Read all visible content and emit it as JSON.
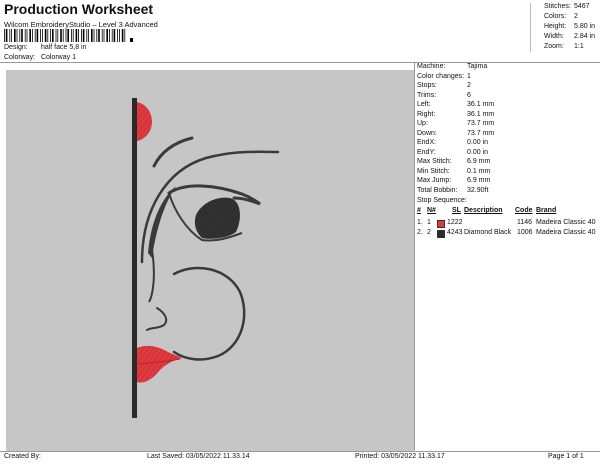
{
  "header": {
    "title": "Production Worksheet",
    "subtitle": "Wilcom EmbroideryStudio – Level 3 Advanced",
    "design_label": "Design:",
    "design_value": "half face 5,8 in",
    "colorway_label": "Colorway:",
    "colorway_value": "Colorway 1"
  },
  "summary": [
    {
      "label": "Stitches:",
      "value": "5467"
    },
    {
      "label": "Colors:",
      "value": "2"
    },
    {
      "label": "Height:",
      "value": "5.80 in"
    },
    {
      "label": "Width:",
      "value": "2.84 in"
    },
    {
      "label": "Zoom:",
      "value": "1:1"
    }
  ],
  "machine_info": [
    {
      "label": "Machine:",
      "value": "Tajima"
    },
    {
      "label": "Color changes:",
      "value": "1"
    },
    {
      "label": "Stops:",
      "value": "2"
    },
    {
      "label": "Trims:",
      "value": "6"
    },
    {
      "label": "Left:",
      "value": "36.1 mm"
    },
    {
      "label": "Right:",
      "value": "36.1 mm"
    },
    {
      "label": "Up:",
      "value": "73.7 mm"
    },
    {
      "label": "Down:",
      "value": "73.7 mm"
    },
    {
      "label": "EndX:",
      "value": "0.00 in"
    },
    {
      "label": "EndY:",
      "value": "0.00 in"
    },
    {
      "label": "Max Stitch:",
      "value": "6.9 mm"
    },
    {
      "label": "Min Stitch:",
      "value": "0.1 mm"
    },
    {
      "label": "Max Jump:",
      "value": "6.9 mm"
    },
    {
      "label": "Total Bobbin:",
      "value": "32.90ft"
    }
  ],
  "stop_sequence": {
    "title": "Stop Sequence:",
    "headers": [
      "#",
      "N#",
      "SL",
      "Description",
      "Code",
      "Brand"
    ],
    "rows": [
      {
        "idx": "1.",
        "n": "1",
        "color": "#e0393e",
        "sl": "1222",
        "description": "",
        "code": "1146",
        "brand": "Madeira Classic 40"
      },
      {
        "idx": "2.",
        "n": "2",
        "color": "#2a2a2a",
        "sl": "4243",
        "description": "Diamond Black",
        "code": "1006",
        "brand": "Madeira Classic 40"
      }
    ]
  },
  "footer": {
    "created": "Created By:",
    "saved": "Last Saved: 03/05/2022 11.33.14",
    "printed": "Printed: 03/05/2022 11.33.17",
    "page": "Page 1 of 1"
  }
}
